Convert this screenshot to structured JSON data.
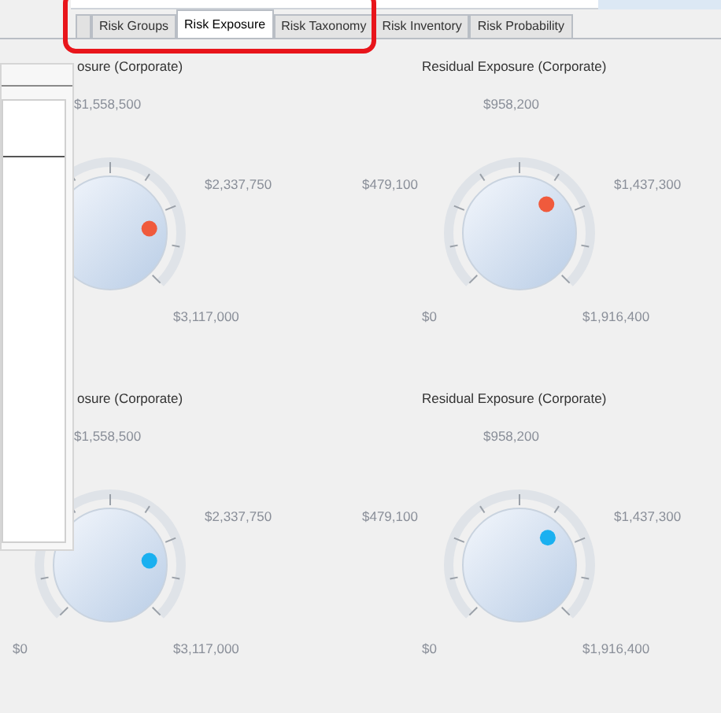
{
  "tabs": [
    {
      "label": "Risk Groups",
      "selected": false
    },
    {
      "label": "Risk Exposure",
      "selected": true
    },
    {
      "label": "Risk Taxonomy",
      "selected": false
    },
    {
      "label": "Risk Inventory",
      "selected": false
    },
    {
      "label": "Risk Probability",
      "selected": false
    }
  ],
  "gauges": [
    {
      "title": "osure (Corporate)",
      "level": 0.81,
      "color": "#f05a3c",
      "scale": {
        "mid": "$1,558,500",
        "three_quarter": "$2,337,750",
        "max": "$3,117,000"
      }
    },
    {
      "title": "Residual Exposure (Corporate)",
      "level": 0.66,
      "color": "#f05a3c",
      "scale": {
        "min": "$0",
        "quarter": "$479,100",
        "mid": "$958,200",
        "three_quarter": "$1,437,300",
        "max": "$1,916,400"
      }
    },
    {
      "title": "osure (Corporate)",
      "level": 0.81,
      "color": "#1ab0f0",
      "scale": {
        "min": "$0",
        "mid": "$1,558,500",
        "three_quarter": "$2,337,750",
        "max": "$3,117,000"
      }
    },
    {
      "title": "Residual Exposure (Corporate)",
      "level": 0.67,
      "color": "#1ab0f0",
      "scale": {
        "min": "$0",
        "quarter": "$479,100",
        "mid": "$958,200",
        "three_quarter": "$1,437,300",
        "max": "$1,916,400"
      }
    }
  ]
}
